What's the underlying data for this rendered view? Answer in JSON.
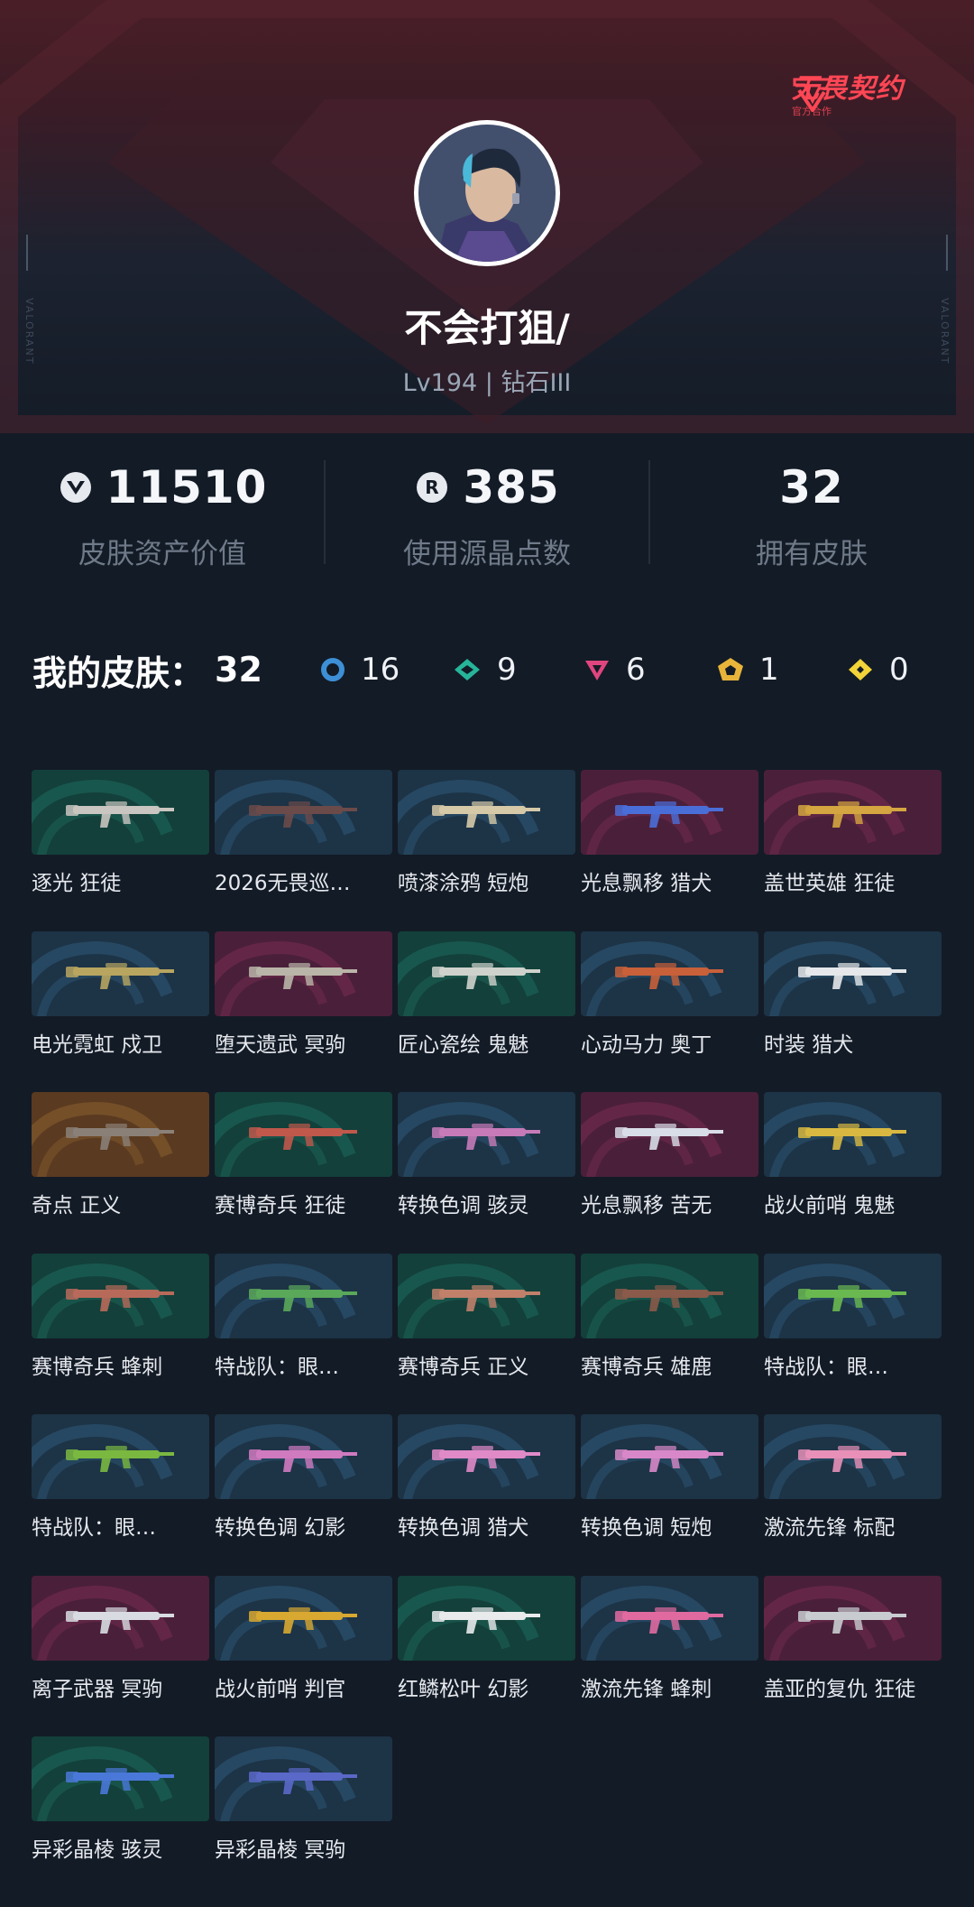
{
  "brand": {
    "name": "无畏契约",
    "sub": "官方合作"
  },
  "side_text": "VALORANT",
  "profile": {
    "username": "不会打狙/",
    "level": "Lv194 | 钻石III"
  },
  "stats": [
    {
      "icon": "valorant-points-icon",
      "value": "11510",
      "label": "皮肤资产价值"
    },
    {
      "icon": "radianite-icon",
      "value": "385",
      "label": "使用源晶点数"
    },
    {
      "icon": "",
      "value": "32",
      "label": "拥有皮肤"
    }
  ],
  "rarity": {
    "title": "我的皮肤：",
    "total": "32",
    "tiers": [
      {
        "name": "select-tier-icon",
        "color": "#3d8fd6",
        "count": "16"
      },
      {
        "name": "deluxe-tier-icon",
        "color": "#27b59a",
        "count": "9"
      },
      {
        "name": "premium-tier-icon",
        "color": "#e0457f",
        "count": "6"
      },
      {
        "name": "ultra-tier-icon",
        "color": "#e8b43a",
        "count": "1"
      },
      {
        "name": "exclusive-tier-icon",
        "color": "#f2d338",
        "count": "0"
      }
    ]
  },
  "skins": [
    {
      "name": "逐光 狂徒",
      "tier": "deluxe",
      "gun": "#c9c5c0"
    },
    {
      "name": "2026无畏巡…",
      "tier": "select",
      "gun": "#6b4a4a"
    },
    {
      "name": "喷漆涂鸦 短炮",
      "tier": "select",
      "gun": "#d6c9a8"
    },
    {
      "name": "光息飘移 猎犬",
      "tier": "premium",
      "gun": "#4a6ed8"
    },
    {
      "name": "盖世英雄 狂徒",
      "tier": "premium",
      "gun": "#d4a540"
    },
    {
      "name": "电光霓虹 戍卫",
      "tier": "select",
      "gun": "#b8a560"
    },
    {
      "name": "堕天遗武 冥驹",
      "tier": "premium",
      "gun": "#b9b5a8"
    },
    {
      "name": "匠心瓷绘 鬼魅",
      "tier": "deluxe",
      "gun": "#cfd2cc"
    },
    {
      "name": "心动马力 奥丁",
      "tier": "select",
      "gun": "#c8603a"
    },
    {
      "name": "时装 猎犬",
      "tier": "select",
      "gun": "#e5e7ea"
    },
    {
      "name": "奇点 正义",
      "tier": "ultra",
      "gun": "#8a8078"
    },
    {
      "name": "赛博奇兵 狂徒",
      "tier": "deluxe",
      "gun": "#c0584c"
    },
    {
      "name": "转换色调 骇灵",
      "tier": "select",
      "gun": "#c77ab8"
    },
    {
      "name": "光息飘移 苦无",
      "tier": "premium",
      "gun": "#d8dde8"
    },
    {
      "name": "战火前哨 鬼魅",
      "tier": "select",
      "gun": "#d8b840"
    },
    {
      "name": "赛博奇兵 蜂刺",
      "tier": "deluxe",
      "gun": "#b86a5a"
    },
    {
      "name": "特战队：眼…",
      "tier": "select",
      "gun": "#5aa85a"
    },
    {
      "name": "赛博奇兵 正义",
      "tier": "deluxe",
      "gun": "#c0806a"
    },
    {
      "name": "赛博奇兵 雄鹿",
      "tier": "deluxe",
      "gun": "#8a5a4a"
    },
    {
      "name": "特战队：眼…",
      "tier": "select",
      "gun": "#6ab850"
    },
    {
      "name": "特战队：眼…",
      "tier": "select",
      "gun": "#7ab840"
    },
    {
      "name": "转换色调 幻影",
      "tier": "select",
      "gun": "#d07ac0"
    },
    {
      "name": "转换色调 猎犬",
      "tier": "select",
      "gun": "#e08ac8"
    },
    {
      "name": "转换色调 短炮",
      "tier": "select",
      "gun": "#d888c8"
    },
    {
      "name": "激流先锋 标配",
      "tier": "select",
      "gun": "#e890b8"
    },
    {
      "name": "离子武器 冥驹",
      "tier": "premium",
      "gun": "#d8dce2"
    },
    {
      "name": "战火前哨 判官",
      "tier": "select",
      "gun": "#d8a830"
    },
    {
      "name": "红鳞松叶 幻影",
      "tier": "deluxe",
      "gun": "#e8eaec"
    },
    {
      "name": "激流先锋 蜂刺",
      "tier": "select",
      "gun": "#e06aa0"
    },
    {
      "name": "盖亚的复仇 狂徒",
      "tier": "premium",
      "gun": "#c8ccd0"
    },
    {
      "name": "异彩晶棱 骇灵",
      "tier": "deluxe",
      "gun": "#4a78d8"
    },
    {
      "name": "异彩晶棱 冥驹",
      "tier": "select",
      "gun": "#5a68c8"
    }
  ],
  "tier_colors": {
    "select": "#1d3346",
    "deluxe": "#13403a",
    "premium": "#4a1f3a",
    "ultra": "#5a3a20"
  }
}
